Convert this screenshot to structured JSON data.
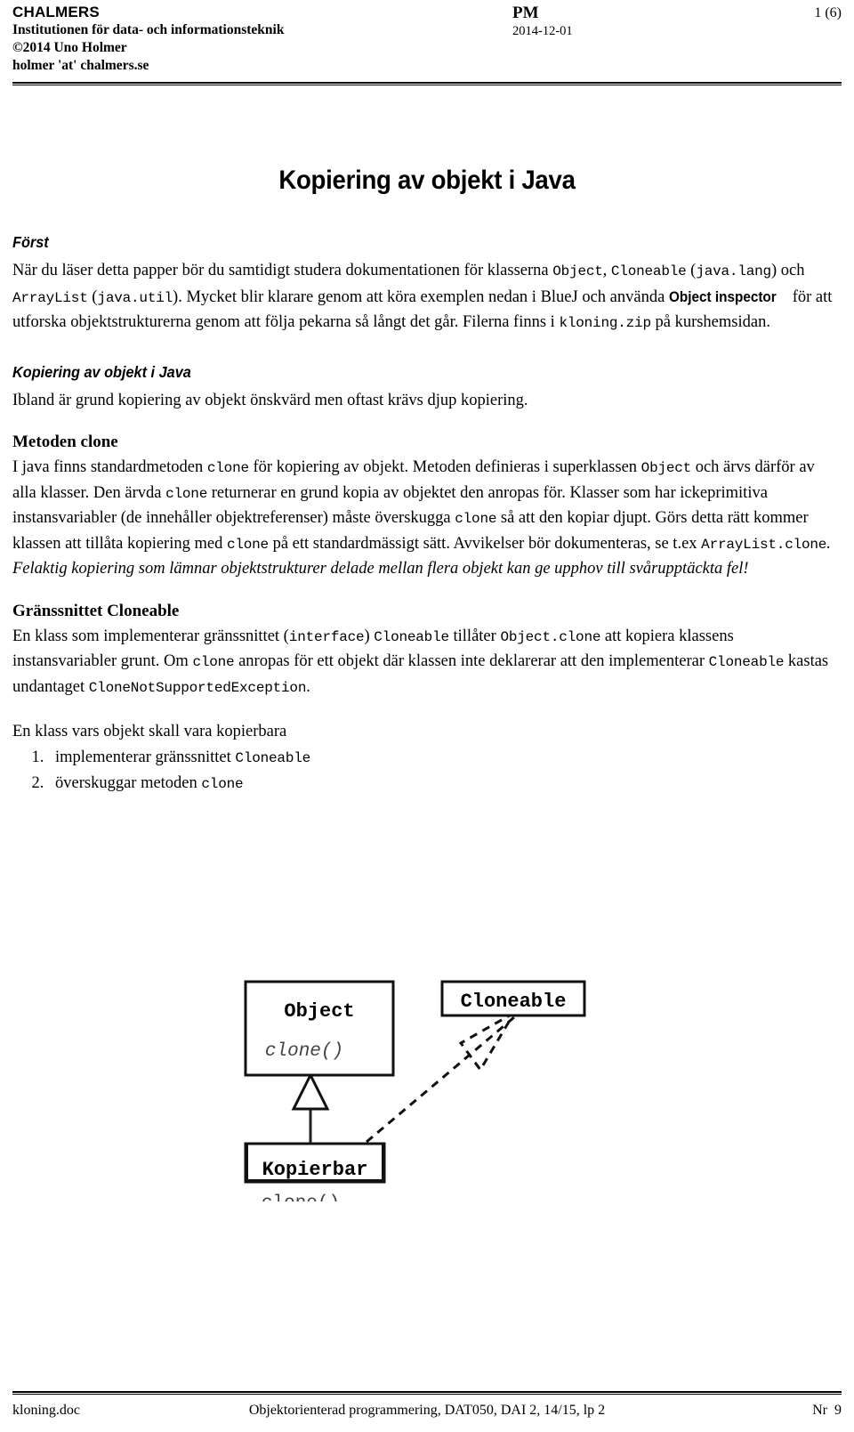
{
  "header": {
    "org": "CHALMERS",
    "department": "Institutionen för data- och informationsteknik",
    "copyright": "©2014 Uno Holmer",
    "email": "holmer 'at' chalmers.se",
    "doc_type": "PM",
    "date": "2014-12-01",
    "page_indicator": "1 (6)"
  },
  "title": "Kopiering av objekt i Java",
  "sections": {
    "forst": {
      "heading": "Först",
      "p1_a": "När du läser detta papper bör du samtidigt studera dokumentationen för klasserna ",
      "p1_code1": "Object",
      "p1_b": ", ",
      "p1_code2": "Cloneable",
      "p1_c": " (",
      "p1_code3": "java.lang",
      "p1_d": ") och ",
      "p1_code4": "ArrayList",
      "p1_e": " (",
      "p1_code5": "java.util",
      "p1_f": "). Mycket blir klarare genom att köra exemplen nedan i BlueJ och använda ",
      "p1_inspector": "Object inspector",
      "p1_g": " för att utforska objektstrukturerna genom att följa pekarna så långt det går. Filerna finns i ",
      "p1_code6": "kloning.zip",
      "p1_h": " på kurshemsidan."
    },
    "kopiering": {
      "heading": "Kopiering av objekt i Java",
      "p1": "Ibland är grund kopiering av objekt önskvärd men oftast krävs djup kopiering."
    },
    "metoden_clone": {
      "heading": "Metoden clone",
      "p_a": "I java finns standardmetoden ",
      "p_code1": "clone",
      "p_b": " för kopiering av objekt. Metoden definieras i superklassen ",
      "p_code2": "Object",
      "p_c": " och ärvs därför av alla klasser. Den ärvda ",
      "p_code3": "clone",
      "p_d": " returnerar en grund kopia av objektet den anropas för. Klasser som har ickeprimitiva instansvariabler (de innehåller objektreferenser) måste överskugga ",
      "p_code4": "clone",
      "p_e": " så att den kopiar djupt. Görs detta rätt kommer klassen att tillåta kopiering med ",
      "p_code5": "clone",
      "p_f": " på ett standardmässigt sätt. Avvikelser bör dokumenteras, se t.ex ",
      "p_code6": "ArrayList.clone",
      "p_italic": ". Felaktig kopiering som lämnar objektstrukturer delade mellan flera objekt kan ge upphov till svårupptäckta fel!"
    },
    "cloneable": {
      "heading": "Gränssnittet Cloneable",
      "p_a": "En klass som implementerar gränssnittet (",
      "p_code1": "interface",
      "p_b": ") ",
      "p_code2": "Cloneable",
      "p_c": " tillåter ",
      "p_code3": "Object.clone",
      "p_d": " att kopiera klassens instansvariabler grunt. Om ",
      "p_code4": "clone",
      "p_e": " anropas för ett objekt där klassen inte deklarerar att den implementerar ",
      "p_code5": "Cloneable",
      "p_f": " kastas undantaget ",
      "p_code6": "CloneNotSupportedException",
      "p_g": "."
    },
    "kopierbara": {
      "intro": "En klass vars objekt skall vara kopierbara",
      "items": [
        {
          "text_a": "implementerar gränssnittet ",
          "code": "Cloneable",
          "text_b": ""
        },
        {
          "text_a": "överskuggar metoden ",
          "code": "clone",
          "text_b": ""
        }
      ]
    }
  },
  "diagram": {
    "object_box": {
      "name": "Object",
      "method": "clone()"
    },
    "cloneable_box": {
      "name": "Cloneable"
    },
    "kopierbar_box": {
      "name": "Kopierbar",
      "method": "clone()"
    }
  },
  "footer": {
    "left": "kloning.doc",
    "center": "Objektorienterad programmering, DAT050, DAI 2, 14/15, lp 2",
    "right": "Nr  9"
  }
}
